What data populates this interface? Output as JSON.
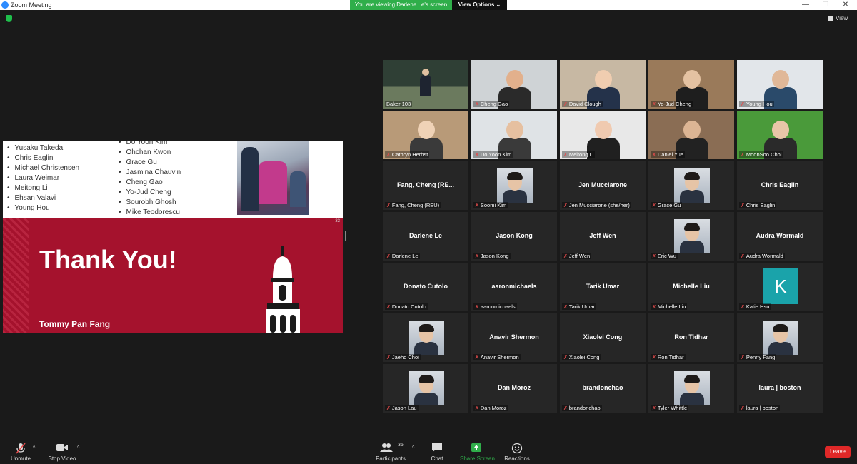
{
  "window": {
    "title": "Zoom Meeting",
    "banner": "You are viewing Darlene Le's screen",
    "view_options": "View Options",
    "view_button": "View"
  },
  "shared_slide": {
    "names_col1": [
      "Yusaku Takeda",
      "Chris Eaglin",
      "Michael Christensen",
      "Laura Weimar",
      "Meitong Li",
      "Ehsan Valavi",
      "Young Hou"
    ],
    "names_col2": [
      "Do Yoon Kim",
      "Ohchan Kwon",
      "Grace Gu",
      "Jasmina Chauvin",
      "Cheng Gao",
      "Yo-Jud Cheng",
      "Sourobh Ghosh",
      "Mike Teodorescu"
    ],
    "slide_number": "33",
    "headline": "Thank You!",
    "presenter": "Tommy Pan Fang"
  },
  "gallery": [
    {
      "label": "Baker 103",
      "video": true,
      "muted": false
    },
    {
      "label": "Cheng Gao",
      "video": true,
      "muted": true
    },
    {
      "label": "David Clough",
      "video": true,
      "muted": true
    },
    {
      "label": "Yo-Jud Cheng",
      "video": true,
      "muted": true
    },
    {
      "label": "Young Hou",
      "video": true,
      "muted": true
    },
    {
      "label": "Cathryn Herbst",
      "video": true,
      "muted": true
    },
    {
      "label": "Do Yoon Kim",
      "video": true,
      "muted": true
    },
    {
      "label": "Meitong Li",
      "video": true,
      "muted": true
    },
    {
      "label": "Daniel Yue",
      "video": true,
      "muted": true
    },
    {
      "label": "MoonSoo Choi",
      "video": true,
      "muted": true
    },
    {
      "label": "Fang, Cheng (REU)",
      "bigname": "Fang, Cheng  (RE...",
      "muted": true
    },
    {
      "label": "Soomi Kim",
      "photo": true,
      "muted": true
    },
    {
      "label": "Jen Mucciarone (she/her)",
      "bigname": "Jen Mucciarone",
      "muted": true
    },
    {
      "label": "Grace Gu",
      "photo": true,
      "muted": true
    },
    {
      "label": "Chris Eaglin",
      "bigname": "Chris Eaglin",
      "muted": true
    },
    {
      "label": "Darlene Le",
      "bigname": "Darlene Le",
      "muted": true
    },
    {
      "label": "Jason Kong",
      "bigname": "Jason Kong",
      "muted": true
    },
    {
      "label": "Jeff Wen",
      "bigname": "Jeff Wen",
      "muted": true
    },
    {
      "label": "Eric Wu",
      "photo": true,
      "muted": true
    },
    {
      "label": "Audra Wormald",
      "bigname": "Audra Wormald",
      "muted": true
    },
    {
      "label": "Donato Cutolo",
      "bigname": "Donato Cutolo",
      "muted": true
    },
    {
      "label": "aaronmichaels",
      "bigname": "aaronmichaels",
      "muted": true
    },
    {
      "label": "Tarik Umar",
      "bigname": "Tarik Umar",
      "muted": true
    },
    {
      "label": "Michelle Liu",
      "bigname": "Michelle Liu",
      "muted": true
    },
    {
      "label": "Katie Hsu",
      "initial": "K",
      "muted": true
    },
    {
      "label": "Jaeho Choi",
      "photo": true,
      "muted": true
    },
    {
      "label": "Anavir Shermon",
      "bigname": "Anavir Shermon",
      "muted": true
    },
    {
      "label": "Xiaolei Cong",
      "bigname": "Xiaolei Cong",
      "muted": true
    },
    {
      "label": "Ron Tidhar",
      "bigname": "Ron Tidhar",
      "muted": true
    },
    {
      "label": "Penny Fang",
      "photo": true,
      "muted": true
    },
    {
      "label": "Jason Lau",
      "photo": true,
      "muted": true
    },
    {
      "label": "Dan Moroz",
      "bigname": "Dan Moroz",
      "muted": true
    },
    {
      "label": "brandonchao",
      "bigname": "brandonchao",
      "muted": true
    },
    {
      "label": "Tyler Whittle",
      "photo": true,
      "muted": true
    },
    {
      "label": "laura | boston",
      "bigname": "laura | boston",
      "muted": true
    }
  ],
  "toolbar": {
    "unmute": "Unmute",
    "stop_video": "Stop Video",
    "participants": "Participants",
    "participant_count": "35",
    "chat": "Chat",
    "share_screen": "Share Screen",
    "reactions": "Reactions",
    "leave": "Leave"
  },
  "colors": {
    "accent_green": "#2fae4a",
    "active_speaker": "#c8e33b",
    "slide_red": "#a5122d",
    "leave_red": "#e02828"
  }
}
